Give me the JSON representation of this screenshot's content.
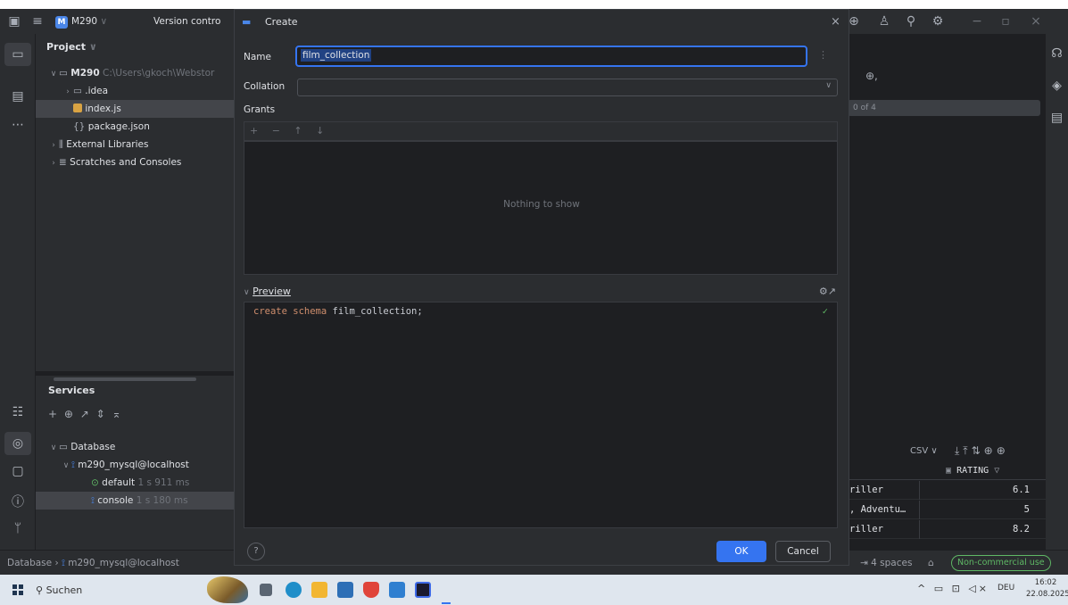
{
  "titlebar": {
    "project": "M290",
    "project_badge": "M",
    "vcs": "Version contro",
    "dialog_title": "Create"
  },
  "project_panel": {
    "title": "Project",
    "tree": [
      {
        "label": "M290",
        "path": "C:\\Users\\gkoch\\Webstor",
        "type": "folder",
        "level": 0
      },
      {
        "label": ".idea",
        "type": "folder",
        "level": 1
      },
      {
        "label": "index.js",
        "type": "file-js",
        "level": 1,
        "selected": true
      },
      {
        "label": "package.json",
        "type": "file-json",
        "level": 1
      },
      {
        "label": "External Libraries",
        "type": "lib",
        "level": 0
      },
      {
        "label": "Scratches and Consoles",
        "type": "scratch",
        "level": 0
      }
    ]
  },
  "services": {
    "title": "Services",
    "toolbar": "+ ⊕ ↗ ⇕ ⌅",
    "tree": [
      {
        "label": "Database",
        "level": 0
      },
      {
        "label": "m290_mysql@localhost",
        "level": 1
      },
      {
        "label": "default",
        "time": "1 s 911 ms",
        "level": 2
      },
      {
        "label": "console",
        "time": "1 s 180 ms",
        "level": 2,
        "selected": true
      }
    ]
  },
  "dialog": {
    "name_label": "Name",
    "name_value": "film_collection",
    "collation_label": "Collation",
    "grants_label": "Grants",
    "grants_toolbar": "+ − ↑ ↓",
    "empty_text": "Nothing to show",
    "preview_label": "Preview",
    "preview_code_kw": "create schema",
    "preview_code_rest": " film_collection;",
    "help": "?",
    "ok": "OK",
    "cancel": "Cancel"
  },
  "right_panel": {
    "search_count": "0 of 4",
    "export": "CSV ∨",
    "column": "RATING",
    "rows": [
      {
        "genre": "riller",
        "rating": "6.1"
      },
      {
        "genre": ", Adventu…",
        "rating": "5"
      },
      {
        "genre": "riller",
        "rating": "8.2"
      }
    ]
  },
  "statusbar": {
    "breadcrumb_db": "Database",
    "breadcrumb_conn": "m290_mysql@localhost",
    "indent": "4 spaces",
    "license": "Non-commercial use"
  },
  "taskbar": {
    "search": "Suchen",
    "lang": "DEU",
    "time": "16:02",
    "date": "22.08.2025"
  },
  "colors": {
    "accent": "#3574f0",
    "bg": "#1e1f22",
    "panel": "#2b2d30",
    "keyword": "#cf8e6d",
    "check": "#5fb865"
  }
}
